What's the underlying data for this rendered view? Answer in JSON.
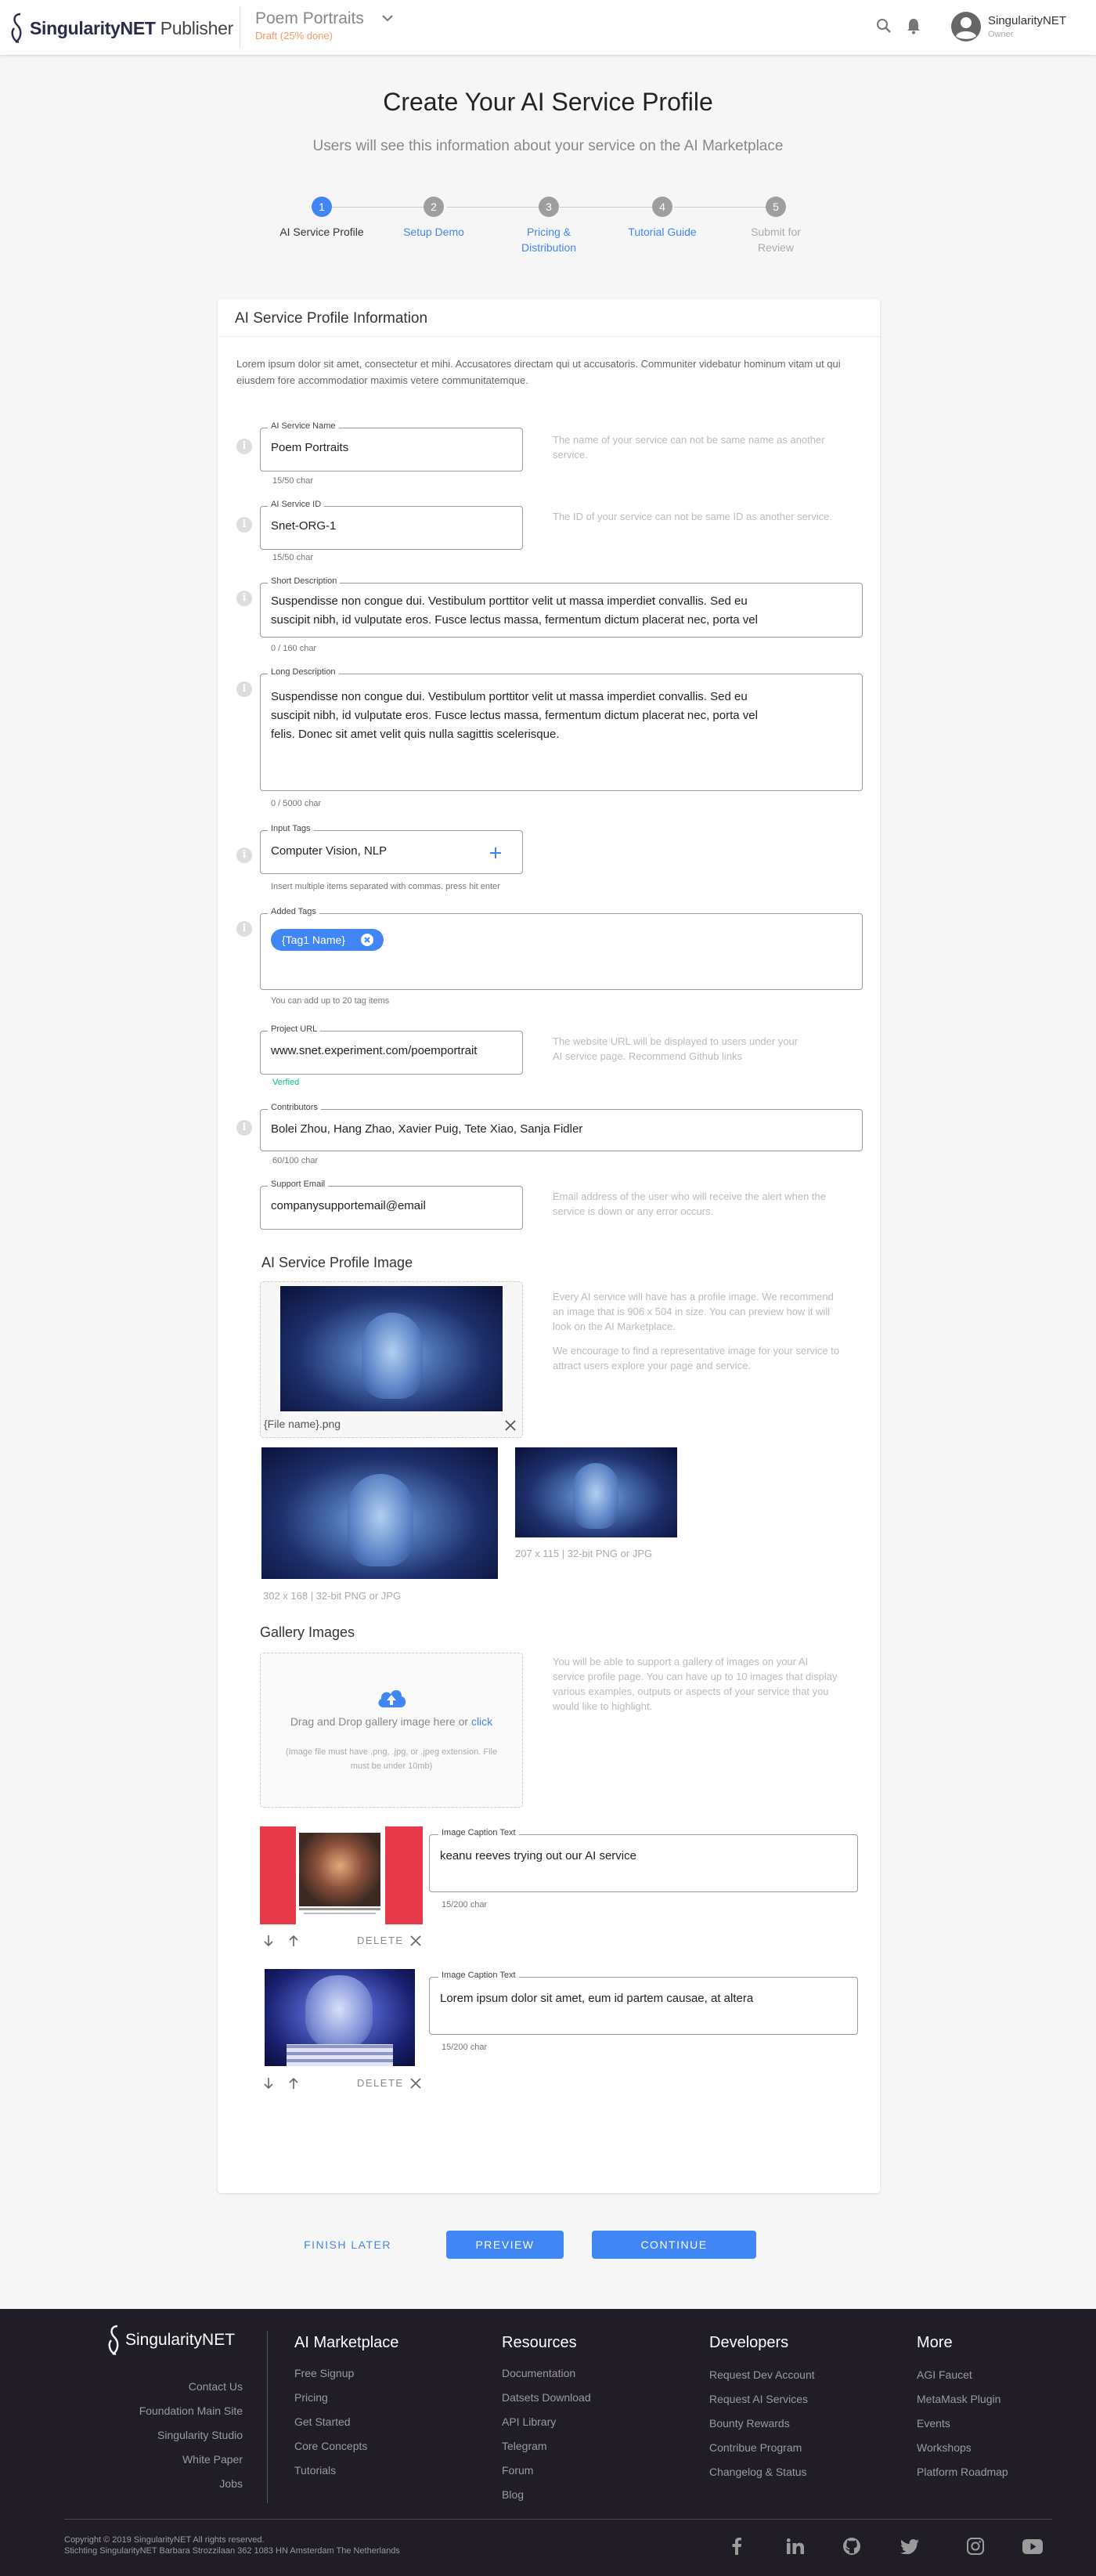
{
  "header": {
    "brand_bold": "SingularityNET",
    "brand_rest": " Publisher",
    "service_title": "Poem Portraits",
    "service_status": "Draft (25% done)",
    "user_name": "SingularityNET",
    "user_role": "Owner",
    "icons": [
      "search-icon",
      "bell-icon",
      "account-circle-icon",
      "chevron-down-icon"
    ]
  },
  "page": {
    "title": "Create Your AI Service Profile",
    "subtitle": "Users will see this information about your service on the AI Marketplace"
  },
  "stepper": [
    {
      "num": "1",
      "label": "AI Service Profile",
      "state": "active"
    },
    {
      "num": "2",
      "label": "Setup Demo",
      "state": "link"
    },
    {
      "num": "3",
      "label": "Pricing &",
      "label2": "Distribution",
      "state": "link"
    },
    {
      "num": "4",
      "label": "Tutorial Guide",
      "state": "link"
    },
    {
      "num": "5",
      "label": "Submit for",
      "label2": "Review",
      "state": "disabled"
    }
  ],
  "form": {
    "card_title": "AI Service Profile Information",
    "description": "Lorem ipsum dolor sit amet, consectetur et mihi. Accusatores directam qui ut accusatoris. Communiter videbatur hominum vitam ut qui eiusdem fore accommodatior maximis vetere communitatemque.",
    "service_name": {
      "label": "AI Service Name",
      "value": "Poem Portraits",
      "counter": "15/50 char",
      "help": "The name of your service can not be same name as another service."
    },
    "service_id": {
      "label": "AI Service ID",
      "value": "Snet-ORG-1",
      "counter": "15/50 char",
      "help": "The ID of your service can not be same ID as another service."
    },
    "short_desc": {
      "label": "Short Description",
      "line1": "Suspendisse non congue dui. Vestibulum porttitor velit ut massa imperdiet convallis. Sed eu",
      "line2": "suscipit nibh, id vulputate eros. Fusce lectus massa, fermentum dictum placerat nec, porta vel",
      "counter": "0 / 160 char"
    },
    "long_desc": {
      "label": "Long Description",
      "line1": "Suspendisse non congue dui. Vestibulum porttitor velit ut massa imperdiet convallis. Sed eu",
      "line2": "suscipit nibh, id vulputate eros. Fusce lectus massa, fermentum dictum placerat nec, porta vel",
      "line3": "felis. Donec sit amet velit quis nulla sagittis scelerisque.",
      "counter": "0 / 5000 char"
    },
    "input_tags": {
      "label": "Input Tags",
      "value": "Computer Vision, NLP",
      "hint": "Insert multiple items separated with commas. press hit enter"
    },
    "added_tags": {
      "label": "Added Tags",
      "chip": "{Tag1 Name}",
      "hint": "You can add up to 20 tag items"
    },
    "project_url": {
      "label": "Project URL",
      "value": "www.snet.experiment.com/poemportrait",
      "status": "Verfied",
      "help1": "The website URL will be displayed to users under your",
      "help2": "AI service page.   Recommend Github links"
    },
    "contributors": {
      "label": "Contributors",
      "value": "Bolei Zhou, Hang Zhao, Xavier Puig, Tete Xiao, Sanja Fidler",
      "counter": "60/100 char"
    },
    "support_email": {
      "label": "Support Email",
      "value": "companysupportemail@email",
      "help": "Email address of the user who will receive the alert when the service is down or any error occurs."
    }
  },
  "profile_image": {
    "section_title": "AI Service Profile Image",
    "file_name": "{File name}.png",
    "help1": "Every AI service will have has a profile image.  We recommend an image that is 906 x 504 in size.  You can preview how it will look on the AI Marketplace.",
    "help2": "We encourage to find a representative image for your service to attract users explore your page and service.",
    "large_caption": "302 x 168 | 32-bit PNG or JPG",
    "small_caption": "207 x 115  | 32-bit PNG or JPG"
  },
  "gallery": {
    "section_title": "Gallery Images",
    "drop_text": "Drag and Drop gallery image here or ",
    "drop_link": "click",
    "drop_note": "(Image file must have .png, .jpg, or .jpeg extension.  File must be under 10mb)",
    "help": "You will be able to support a gallery of images on your AI service profile page.  You can have up to 10 images that display various examples, outputs or aspects of your service that you would like to highlight.",
    "items": [
      {
        "caption_label": "Image Caption Text",
        "caption": "keanu reeves trying out our AI service",
        "counter": "15/200 char",
        "delete": "DELETE"
      },
      {
        "caption_label": "Image Caption Text",
        "caption": "Lorem ipsum dolor sit amet, eum id partem causae, at altera",
        "counter": "15/200 char",
        "delete": "DELETE"
      }
    ]
  },
  "actions": {
    "finish_later": "FINISH LATER",
    "preview": "PREVIEW",
    "continue": "CONTINUE"
  },
  "footer": {
    "brand": "SingularityNET",
    "main_links": [
      "Contact Us",
      "Foundation Main Site",
      "Singularity Studio",
      "White Paper",
      "Jobs"
    ],
    "columns": [
      {
        "title": "AI Marketplace",
        "links": [
          "Free Signup",
          "Pricing",
          "Get Started",
          "Core Concepts",
          "Tutorials"
        ]
      },
      {
        "title": "Resources",
        "links": [
          "Documentation",
          "Datsets Download",
          "API Library",
          "Telegram",
          "Forum",
          "Blog"
        ]
      },
      {
        "title": "Developers",
        "links": [
          "Request Dev Account",
          "Request AI Services",
          "Bounty Rewards",
          "Contribue Program",
          "Changelog & Status"
        ]
      },
      {
        "title": "More",
        "links": [
          "AGI Faucet",
          "MetaMask Plugin",
          "Events",
          "Workshops",
          "Platform Roadmap"
        ]
      }
    ],
    "copyright": "Copyright © 2019 SingularityNET All rights reserved.",
    "address": "Stichting SingularityNET Barbara Strozzilaan 362 1083 HN Amsterdam The Netherlands",
    "social_icons": [
      "facebook-icon",
      "linkedin-icon",
      "github-icon",
      "twitter-icon",
      "instagram-icon",
      "youtube-icon"
    ]
  },
  "colors": {
    "accent": "#4086f4",
    "draft": "#f29a5c",
    "verified": "#00c48c",
    "footer_bg": "#211d26"
  }
}
